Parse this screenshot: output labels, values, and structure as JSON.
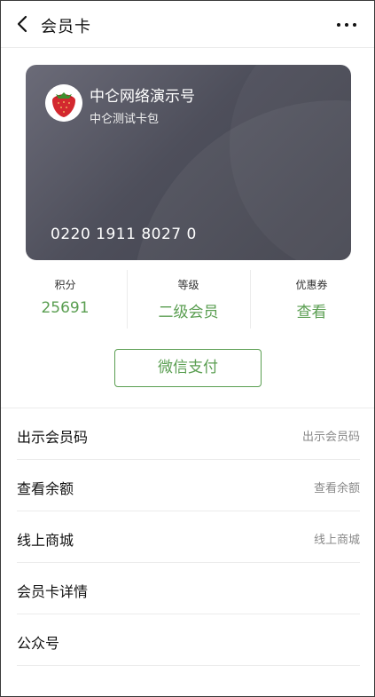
{
  "header": {
    "title": "会员卡"
  },
  "card": {
    "merchant_name": "中仑网络演示号",
    "card_name": "中仑测试卡包",
    "card_number": "0220 1911 8027 0"
  },
  "stats": [
    {
      "label": "积分",
      "value": "25691"
    },
    {
      "label": "等级",
      "value": "二级会员"
    },
    {
      "label": "优惠券",
      "value": "查看"
    }
  ],
  "pay_button_label": "微信支付",
  "menu": [
    {
      "title": "出示会员码",
      "hint": "出示会员码"
    },
    {
      "title": "查看余额",
      "hint": "查看余额"
    },
    {
      "title": "线上商城",
      "hint": "线上商城"
    },
    {
      "title": "会员卡详情",
      "hint": ""
    },
    {
      "title": "公众号",
      "hint": ""
    }
  ],
  "colors": {
    "accent": "#5a9e51",
    "card_dark": "#3f404b",
    "card_light": "#6b6b78"
  },
  "icons": {
    "back": "chevron-left-icon",
    "more": "more-dots-icon",
    "logo": "strawberry-logo"
  }
}
